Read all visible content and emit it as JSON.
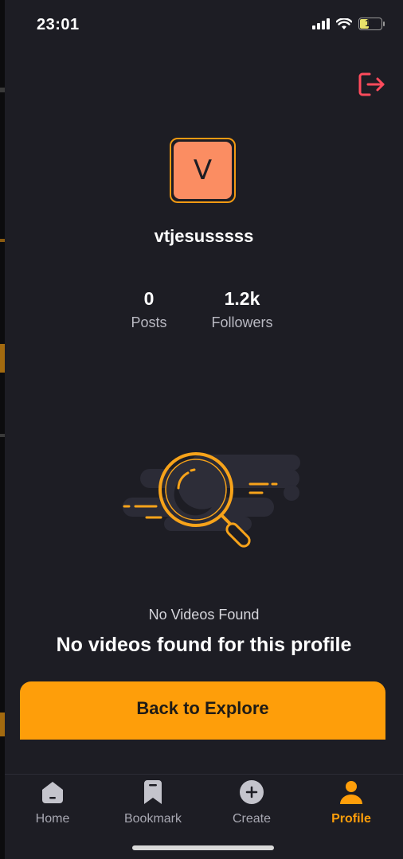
{
  "status_bar": {
    "time": "23:01",
    "battery_level": "17",
    "icons": [
      "signal-icon",
      "wifi-icon",
      "battery-icon"
    ]
  },
  "header": {
    "logout_icon": "logout-icon"
  },
  "profile": {
    "avatar_initial": "V",
    "username": "vtjesusssss",
    "stats": {
      "posts": {
        "value": "0",
        "label": "Posts"
      },
      "followers": {
        "value": "1.2k",
        "label": "Followers"
      }
    }
  },
  "empty_state": {
    "illustration": "magnifier-search-illustration",
    "title": "No Videos Found",
    "message": "No videos found for this profile"
  },
  "actions": {
    "back_to_explore": "Back to Explore"
  },
  "tabbar": {
    "items": [
      {
        "label": "Home",
        "icon": "home-icon",
        "active": false
      },
      {
        "label": "Bookmark",
        "icon": "bookmark-icon",
        "active": false
      },
      {
        "label": "Create",
        "icon": "plus-circle-icon",
        "active": false
      },
      {
        "label": "Profile",
        "icon": "person-icon",
        "active": true
      }
    ]
  },
  "colors": {
    "background": "#1d1d24",
    "accent": "#fe9e0a",
    "avatar": "#fb8d62",
    "logout": "#ff4b5c",
    "muted_text": "#b9b9c2"
  }
}
